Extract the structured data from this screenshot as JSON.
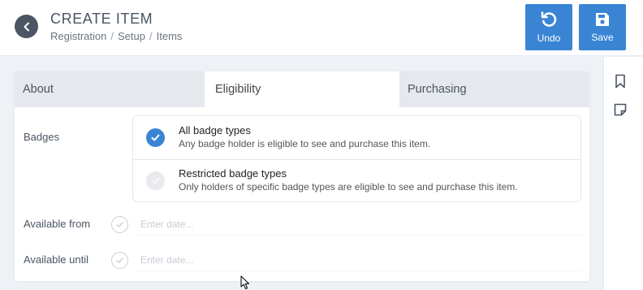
{
  "header": {
    "title": "CREATE ITEM",
    "breadcrumb": [
      "Registration",
      "Setup",
      "Items"
    ],
    "breadcrumb_separator": "/",
    "actions": [
      {
        "label": "Undo",
        "icon": "undo-icon"
      },
      {
        "label": "Save",
        "icon": "floppy-disk-icon"
      }
    ]
  },
  "tabs": [
    {
      "label": "About",
      "active": false
    },
    {
      "label": "Eligibility",
      "active": true
    },
    {
      "label": "Purchasing",
      "active": false
    }
  ],
  "form": {
    "badges_label": "Badges",
    "badge_options": [
      {
        "title": "All badge types",
        "description": "Any badge holder is eligible to see and purchase this item.",
        "selected": true
      },
      {
        "title": "Restricted badge types",
        "description": "Only holders of specific badge types are eligible to see and purchase this item.",
        "selected": false
      }
    ],
    "available_from": {
      "label": "Available from",
      "placeholder": "Enter date...",
      "value": ""
    },
    "available_until": {
      "label": "Available until",
      "placeholder": "Enter date...",
      "value": ""
    }
  },
  "rail": {
    "icons": [
      "bookmark-icon",
      "note-icon"
    ]
  },
  "colors": {
    "accent": "#3a84d4",
    "selected_check": "#3a84d4",
    "unselected_check": "#e8eaed",
    "tab_inactive_bg": "#e5e8ed",
    "page_bg": "#eef1f5"
  }
}
